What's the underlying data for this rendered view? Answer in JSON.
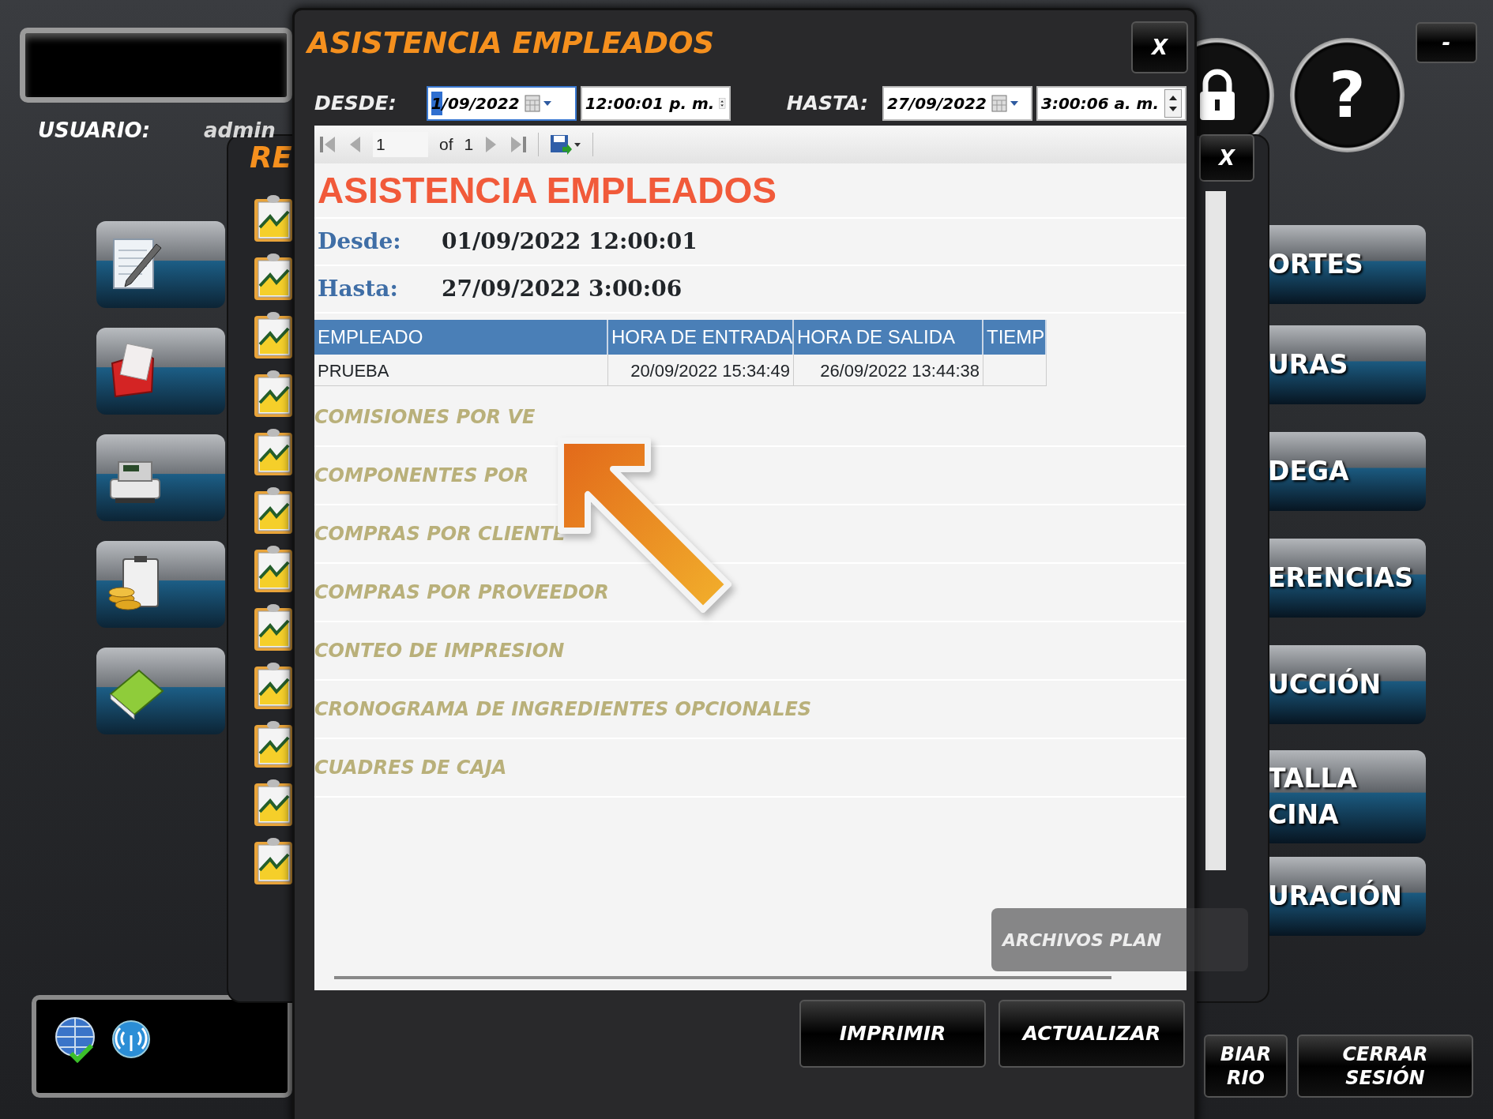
{
  "main_window": {
    "user_label": "USUARIO:",
    "user_value": "admin",
    "right_menu": [
      {
        "lines": [
          "ORTES"
        ]
      },
      {
        "lines": [
          "URAS"
        ]
      },
      {
        "lines": [
          "DEGA"
        ]
      },
      {
        "lines": [
          "ERENCIAS"
        ]
      },
      {
        "lines": [
          "UCCIÓN"
        ]
      },
      {
        "lines": [
          "TALLA",
          "CINA"
        ]
      },
      {
        "lines": [
          "URACIÓN"
        ]
      }
    ],
    "minimize": "-",
    "help": "?",
    "bottom_buttons": [
      {
        "lines": [
          "BIAR",
          "RIO"
        ]
      },
      {
        "lines": [
          "CERRAR",
          "SESIÓN"
        ]
      }
    ]
  },
  "reports_window": {
    "title": "RE",
    "close": "X",
    "flat_files": "ARCHIVOS PLAN",
    "items": [
      "COMISIONES POR VE",
      "COMPONENTES POR",
      "COMPRAS POR CLIENTE",
      "COMPRAS POR PROVEEDOR",
      "CONTEO DE IMPRESION",
      "CRONOGRAMA DE INGREDIENTES OPCIONALES",
      "CUADRES DE CAJA"
    ]
  },
  "report_dialog": {
    "title": "ASISTENCIA EMPLEADOS",
    "close": "X",
    "from_label": "DESDE:",
    "from_date": "1/09/2022",
    "from_time": "12:00:01 p. m.",
    "to_label": "HASTA:",
    "to_date": "27/09/2022",
    "to_time": "3:00:06 a. m.",
    "toolbar": {
      "page": "1",
      "of": "of",
      "total": "1"
    },
    "report": {
      "title": "ASISTENCIA EMPLEADOS",
      "from_label": "Desde:",
      "from_value": "01/09/2022 12:00:01",
      "to_label": "Hasta:",
      "to_value": "27/09/2022 3:00:06",
      "columns": [
        "EMPLEADO",
        "HORA DE ENTRADA",
        "HORA DE SALIDA",
        "TIEMP"
      ],
      "rows": [
        [
          "PRUEBA",
          "20/09/2022 15:34:49",
          "26/09/2022 13:44:38"
        ]
      ]
    },
    "buttons": [
      "IMPRIMIR",
      "ACTUALIZAR"
    ]
  }
}
